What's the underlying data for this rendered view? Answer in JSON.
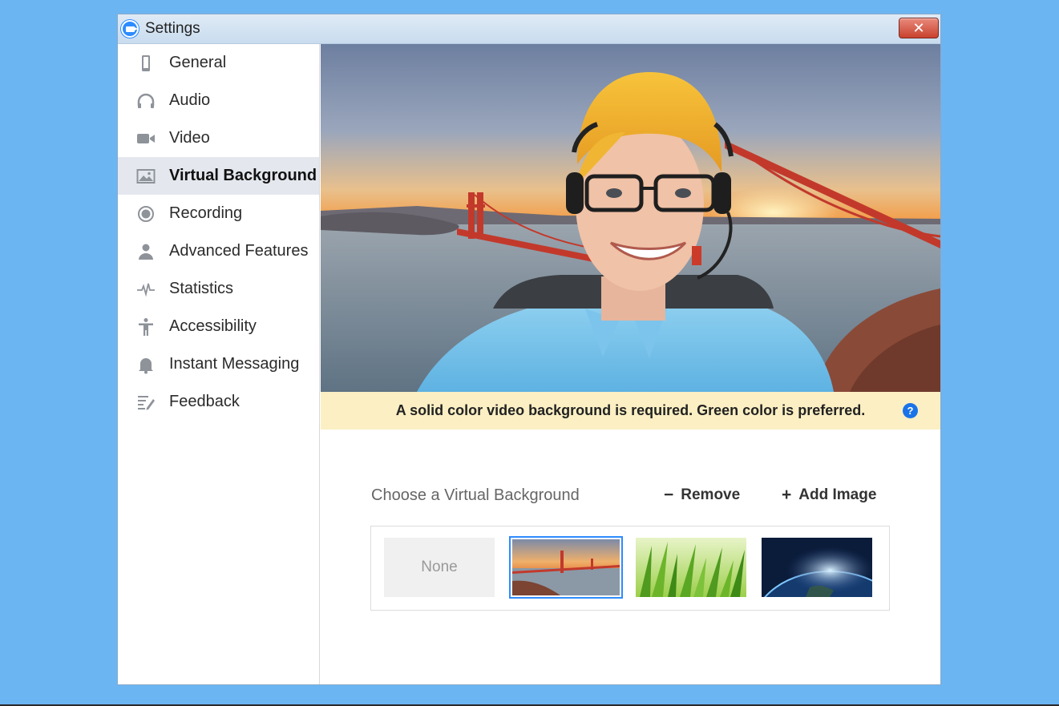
{
  "window": {
    "title": "Settings",
    "close_symbol": "✕"
  },
  "sidebar": {
    "items": [
      {
        "label": "General",
        "icon": "phone-icon"
      },
      {
        "label": "Audio",
        "icon": "headphones-icon"
      },
      {
        "label": "Video",
        "icon": "video-camera-icon"
      },
      {
        "label": "Virtual Background",
        "icon": "image-icon",
        "active": true
      },
      {
        "label": "Recording",
        "icon": "record-icon"
      },
      {
        "label": "Advanced Features",
        "icon": "person-icon"
      },
      {
        "label": "Statistics",
        "icon": "pulse-icon"
      },
      {
        "label": "Accessibility",
        "icon": "accessibility-icon"
      },
      {
        "label": "Instant Messaging",
        "icon": "bell-icon"
      },
      {
        "label": "Feedback",
        "icon": "feedback-icon"
      }
    ]
  },
  "main": {
    "notice": "A solid color video background is required. Green color is preferred.",
    "help_symbol": "?",
    "choose_label": "Choose a Virtual Background",
    "remove": {
      "symbol": "−",
      "label": "Remove"
    },
    "add": {
      "symbol": "+",
      "label": "Add Image"
    },
    "thumbnails": {
      "none_label": "None",
      "items": [
        "golden-gate-bridge",
        "grass",
        "earth-from-space"
      ],
      "selected": "golden-gate-bridge"
    }
  },
  "colors": {
    "background": "#6bb5f3",
    "accent": "#2d8cff",
    "notice_bg": "#fbefc3",
    "active_nav": "#e4e8ee"
  }
}
